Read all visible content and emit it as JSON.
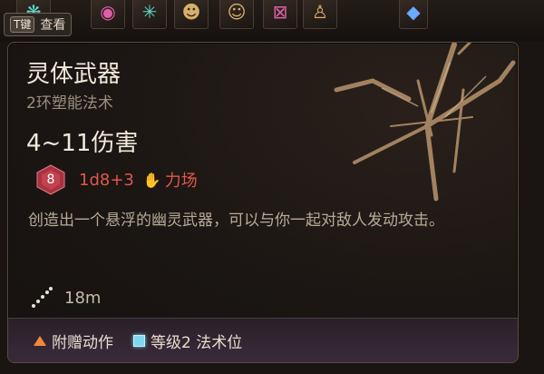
{
  "hotbar": {
    "key_label": "T键",
    "view_label": "查看",
    "slots": [
      {
        "icon": "wing-icon",
        "glyph": "❋",
        "tone": "teal"
      },
      {
        "icon": "eye-icon",
        "glyph": "◉",
        "tone": "pink"
      },
      {
        "icon": "leaf-icon",
        "glyph": "✳",
        "tone": "teal"
      },
      {
        "icon": "mask-icon",
        "glyph": "☻",
        "tone": ""
      },
      {
        "icon": "portrait-icon",
        "glyph": "☺",
        "tone": ""
      },
      {
        "icon": "frame-icon",
        "glyph": "⊠",
        "tone": "pink"
      },
      {
        "icon": "figure-icon",
        "glyph": "♙",
        "tone": ""
      },
      {
        "icon": "gem-icon",
        "glyph": "◆",
        "tone": "blue"
      }
    ]
  },
  "tooltip": {
    "title": "灵体武器",
    "subtitle": "2环塑能法术",
    "damage": "4~11伤害",
    "dice": {
      "face": "8",
      "formula": "1d8+3",
      "damage_type": "力场"
    },
    "description": "创造出一个悬浮的幽灵武器，可以与你一起对敌人发动攻击。",
    "range": "18m",
    "footer": {
      "action_label": "附赠动作",
      "slot_label": "等级2 法术位"
    }
  },
  "colors": {
    "damage_red": "#e0564d",
    "bonus_action_orange": "#f08a3a",
    "spell_slot_cyan": "#7fd8f0"
  }
}
